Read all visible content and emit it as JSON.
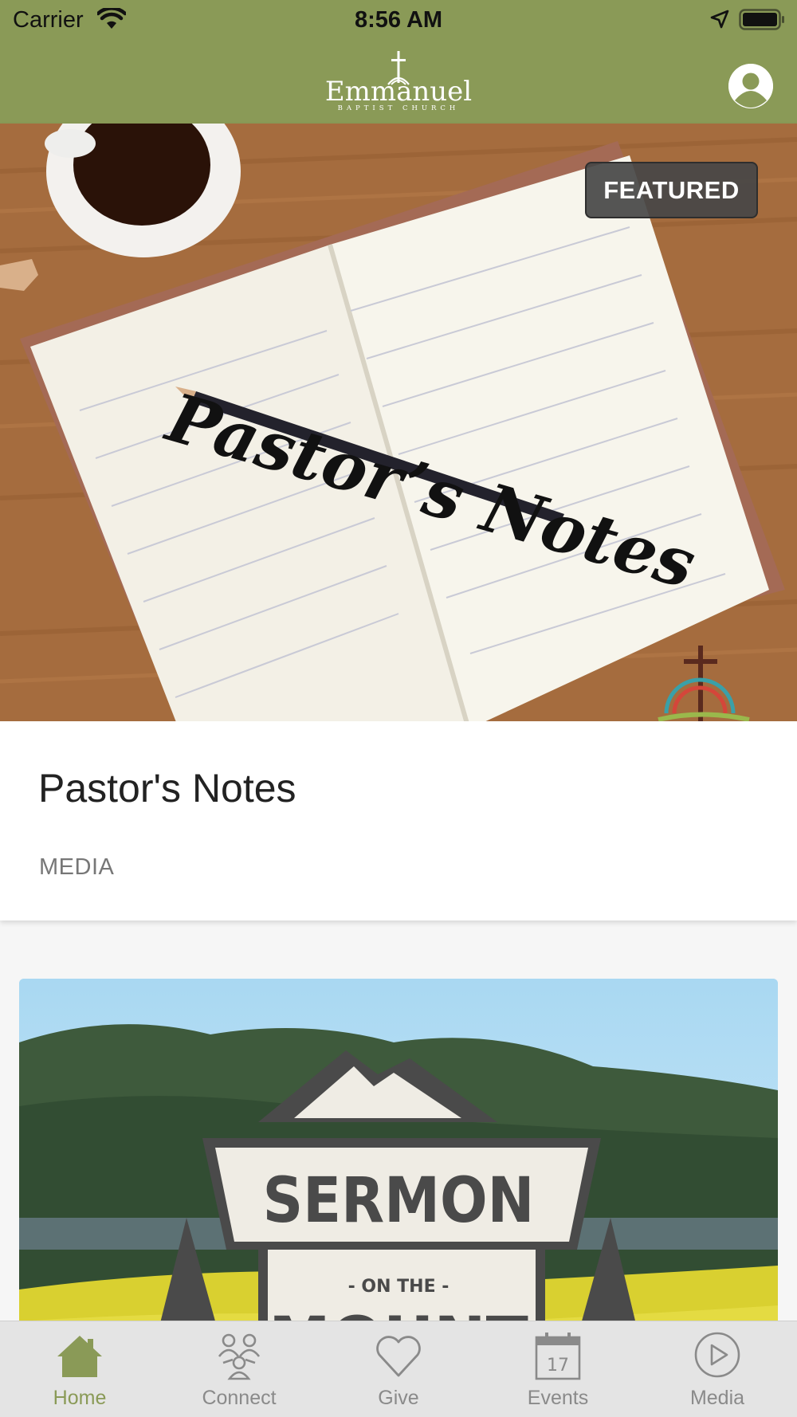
{
  "status_bar": {
    "carrier": "Carrier",
    "time": "8:56 AM",
    "wifi_icon": "wifi-icon",
    "location_icon": "location-arrow-icon",
    "battery_icon": "battery-icon"
  },
  "header": {
    "logo_name": "Emmanuel",
    "logo_sub": "BAPTIST CHURCH",
    "profile_icon": "user-profile-icon",
    "background_color": "#8a9a57"
  },
  "featured_card": {
    "badge": "FEATURED",
    "image_text": "Pastor’s Notes",
    "title": "Pastor's Notes",
    "category": "MEDIA"
  },
  "second_card": {
    "image_title": "SERMON",
    "image_sub": "- ON THE -",
    "image_bottom": "MOUNT"
  },
  "tabs": [
    {
      "label": "Home",
      "icon": "home-icon",
      "active": true
    },
    {
      "label": "Connect",
      "icon": "people-icon",
      "active": false
    },
    {
      "label": "Give",
      "icon": "heart-icon",
      "active": false
    },
    {
      "label": "Events",
      "icon": "calendar-icon",
      "active": false,
      "icon_text": "17"
    },
    {
      "label": "Media",
      "icon": "play-icon",
      "active": false
    }
  ],
  "colors": {
    "accent": "#8a9a57",
    "inactive": "#8a8a8a"
  }
}
